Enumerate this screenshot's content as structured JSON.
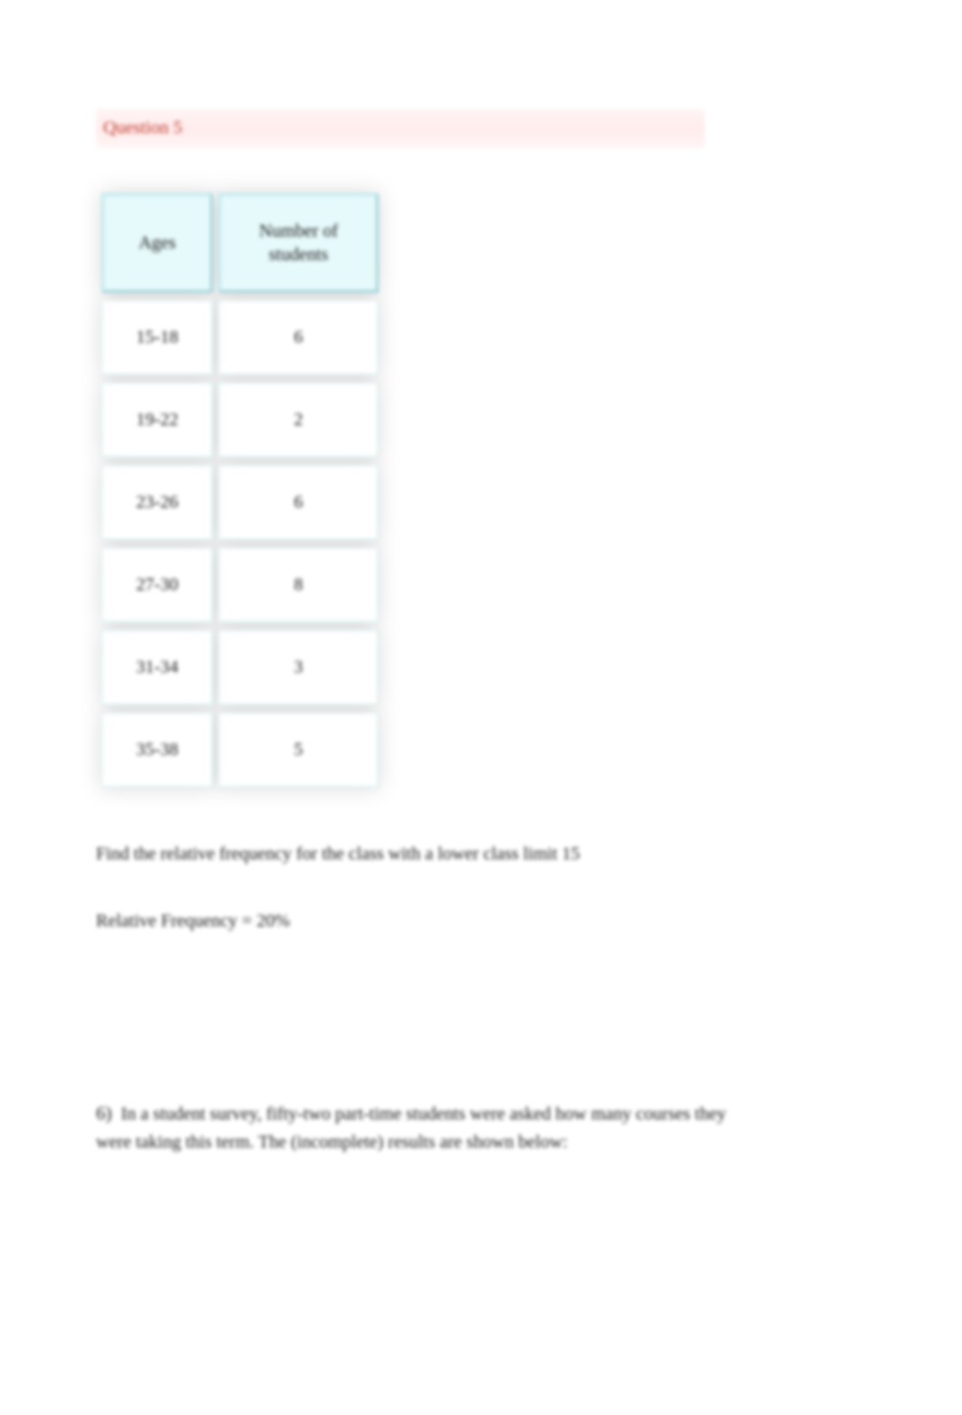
{
  "question5": {
    "header": "Question 5",
    "table": {
      "columns": {
        "ages": "Ages",
        "num_students": "Number of students"
      },
      "rows": [
        {
          "ages": "15-18",
          "count": "6"
        },
        {
          "ages": "19-22",
          "count": "2"
        },
        {
          "ages": "23-26",
          "count": "6"
        },
        {
          "ages": "27-30",
          "count": "8"
        },
        {
          "ages": "31-34",
          "count": "3"
        },
        {
          "ages": "35-38",
          "count": "5"
        }
      ]
    },
    "prompt": "Find the relative frequency for the class with a lower class limit 15",
    "answer": "Relative Frequency = 20%"
  },
  "question6": {
    "number": "6)",
    "text": "In a student survey, fifty-two part-time students were asked how many courses they were taking this term. The (incomplete) results are shown below:"
  },
  "chart_data": {
    "type": "table",
    "title": "Ages vs Number of students",
    "columns": [
      "Ages",
      "Number of students"
    ],
    "rows": [
      [
        "15-18",
        6
      ],
      [
        "19-22",
        2
      ],
      [
        "23-26",
        6
      ],
      [
        "27-30",
        8
      ],
      [
        "31-34",
        3
      ],
      [
        "35-38",
        5
      ]
    ]
  }
}
